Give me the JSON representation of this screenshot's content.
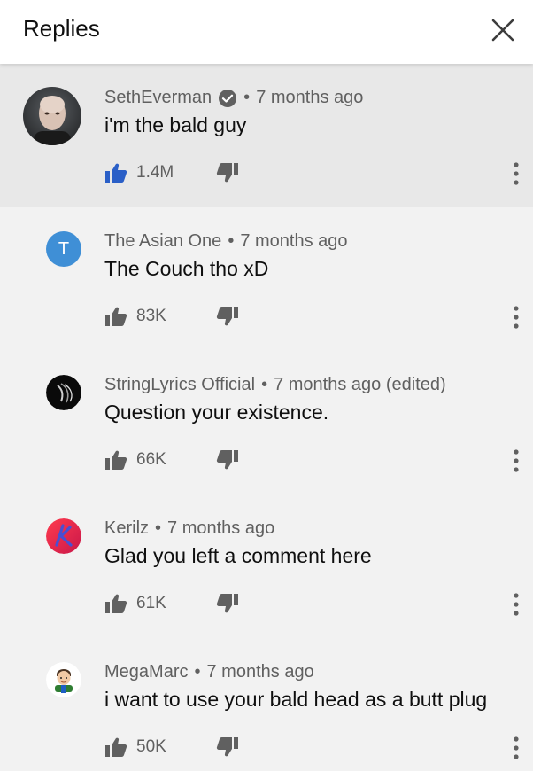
{
  "header": {
    "title": "Replies",
    "close_icon": "close-icon"
  },
  "colors": {
    "liked": "#2a5fc7",
    "icon_gray": "#606060",
    "highlight_bg": "#e8e8e8",
    "avatar_t": "#3f8fd6"
  },
  "comments": [
    {
      "author": "SethEverman",
      "verified": true,
      "time": "7 months ago",
      "text": "i'm the bald guy",
      "likes": "1.4M",
      "liked": true
    },
    {
      "author": "The Asian One",
      "time": "7 months ago",
      "text": "The Couch tho xD",
      "likes": "83K",
      "avatar_letter": "T"
    },
    {
      "author": "StringLyrics Official",
      "time": "7 months ago (edited)",
      "text": "Question your existence.",
      "likes": "66K"
    },
    {
      "author": "Kerilz",
      "time": "7 months ago",
      "text": "Glad you left a comment here",
      "likes": "61K"
    },
    {
      "author": "MegaMarc",
      "time": "7 months ago",
      "text": "i want to use your bald head as a butt plug",
      "likes": "50K"
    }
  ]
}
